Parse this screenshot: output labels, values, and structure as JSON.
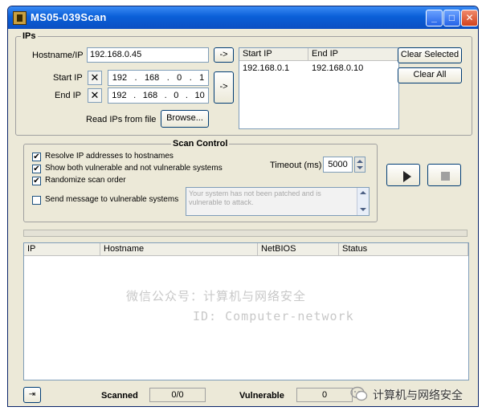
{
  "window": {
    "title": "MS05-039Scan"
  },
  "ips_group": {
    "label": "IPs",
    "hostname_label": "Hostname/IP",
    "hostname_value": "192.168.0.45",
    "add_host_button": "->",
    "start_ip_label": "Start IP",
    "start_ip": [
      "192",
      "168",
      "0",
      "1"
    ],
    "end_ip_label": "End IP",
    "end_ip": [
      "192",
      "168",
      "0",
      "10"
    ],
    "add_range_button": "->",
    "read_file_label": "Read IPs from file",
    "browse_button": "Browse...",
    "list_headers": [
      "Start IP",
      "End IP"
    ],
    "list_rows": [
      {
        "start": "192.168.0.1",
        "end": "192.168.0.10"
      }
    ],
    "clear_selected_button": "Clear Selected",
    "clear_all_button": "Clear All"
  },
  "scan_control": {
    "label": "Scan Control",
    "options": [
      {
        "label": "Resolve IP addresses to hostnames",
        "checked": true
      },
      {
        "label": "Show both vulnerable and not vulnerable systems",
        "checked": true
      },
      {
        "label": "Randomize scan order",
        "checked": true
      }
    ],
    "send_message_label": "Send message to vulnerable systems",
    "send_message_checked": false,
    "message_text": "Your system has not been patched and is vulnerable to attack.",
    "timeout_label": "Timeout (ms)",
    "timeout_value": "5000"
  },
  "results": {
    "headers": [
      "IP",
      "Hostname",
      "NetBIOS",
      "Status"
    ]
  },
  "statusbar": {
    "scanned_label": "Scanned",
    "scanned_value": "0/0",
    "vulnerable_label": "Vulnerable",
    "vulnerable_value": "0"
  },
  "watermark": {
    "line1": "微信公众号：计算机与网络安全",
    "line2": "ID: Computer-network",
    "corner": "计算机与网络安全"
  }
}
